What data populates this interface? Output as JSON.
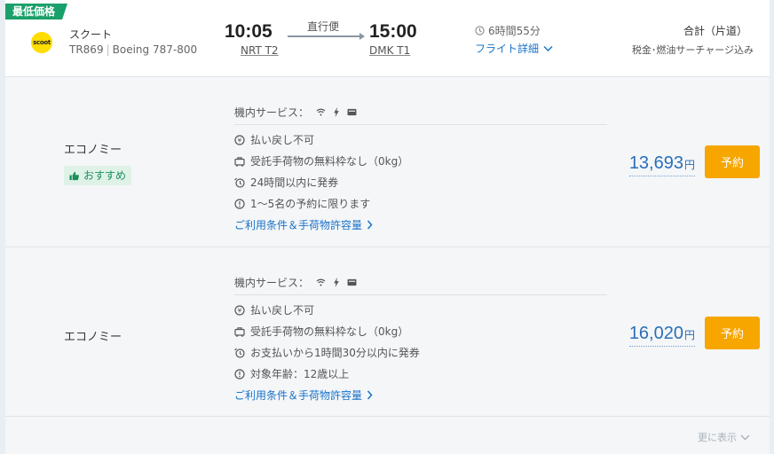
{
  "header": {
    "badge": "最低価格",
    "logo_text": "scoot",
    "airline_name": "スクート",
    "flight_number": "TR869",
    "aircraft": "Boeing 787-800",
    "depart_time": "10:05",
    "depart_airport": "NRT T2",
    "arrive_time": "15:00",
    "arrive_airport": "DMK T1",
    "direct_label": "直行便",
    "duration": "6時間55分",
    "details_link": "フライト詳細",
    "total_label": "合計（片道）",
    "total_note": "税金･燃油サーチャージ込み"
  },
  "fares": [
    {
      "class_name": "エコノミー",
      "recommend_label": "おすすめ",
      "services_label": "機内サービス：",
      "conditions": [
        "払い戻し不可",
        "受託手荷物の無料枠なし（0kg）",
        "24時間以内に発券",
        "1～5名の予約に限ります"
      ],
      "terms_link": "ご利用条件＆手荷物許容量",
      "price": "13,693",
      "currency": "円",
      "book_label": "予約"
    },
    {
      "class_name": "エコノミー",
      "services_label": "機内サービス：",
      "conditions": [
        "払い戻し不可",
        "受託手荷物の無料枠なし（0kg）",
        "お支払いから1時間30分以内に発券",
        "対象年齢：12歳以上"
      ],
      "terms_link": "ご利用条件＆手荷物許容量",
      "price": "16,020",
      "currency": "円",
      "book_label": "予約"
    }
  ],
  "footer": {
    "more_label": "更に表示"
  },
  "icons": [
    "clock-icon",
    "chevron-down-icon",
    "wifi-icon",
    "power-icon",
    "entertainment-icon",
    "refund-icon",
    "baggage-icon",
    "ticketing-icon",
    "info-icon",
    "thumbs-up-icon",
    "chevron-right-icon"
  ],
  "colors": {
    "accent": "#1a73c9",
    "badge": "#1aa06a",
    "book_button": "#f7a600",
    "price": "#2a6fb8"
  }
}
